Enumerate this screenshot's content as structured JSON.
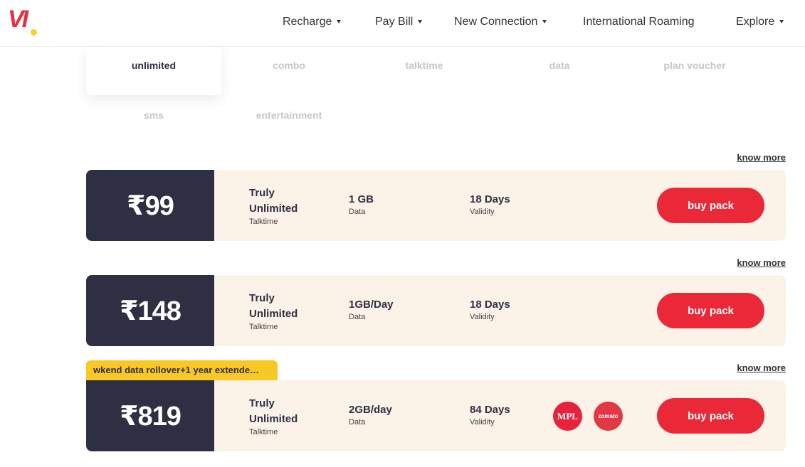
{
  "header": {
    "logo_text": "VI",
    "nav": [
      {
        "label": "Recharge",
        "has_dropdown": true
      },
      {
        "label": "Pay Bill",
        "has_dropdown": true
      },
      {
        "label": "New Connection",
        "has_dropdown": true
      },
      {
        "label": "International Roaming",
        "has_dropdown": false
      },
      {
        "label": "Explore",
        "has_dropdown": true
      }
    ]
  },
  "tabs": [
    {
      "label": "unlimited",
      "active": true
    },
    {
      "label": "combo",
      "active": false
    },
    {
      "label": "talktime",
      "active": false
    },
    {
      "label": "data",
      "active": false
    },
    {
      "label": "plan voucher",
      "active": false
    },
    {
      "label": "sms",
      "active": false
    },
    {
      "label": "entertainment",
      "active": false
    }
  ],
  "packs": [
    {
      "know_more": "know more",
      "price": "₹99",
      "talktime_line1": "Truly",
      "talktime_line2": "Unlimited",
      "talktime_label": "Talktime",
      "data_value": "1 GB",
      "data_label": "Data",
      "validity_value": "18 Days",
      "validity_label": "Validity",
      "buy_label": "buy pack"
    },
    {
      "know_more": "know more",
      "price": "₹148",
      "talktime_line1": "Truly",
      "talktime_line2": "Unlimited",
      "talktime_label": "Talktime",
      "data_value": "1GB/Day",
      "data_label": "Data",
      "validity_value": "18 Days",
      "validity_label": "Validity",
      "buy_label": "buy pack"
    },
    {
      "badge": "wkend data rollover+1 year extende…",
      "know_more": "know more",
      "price": "₹819",
      "talktime_line1": "Truly",
      "talktime_line2": "Unlimited",
      "talktime_label": "Talktime",
      "data_value": "2GB/day",
      "data_label": "Data",
      "validity_value": "84 Days",
      "validity_label": "Validity",
      "benefits": [
        {
          "name": "MPL",
          "icon": "mpl-logo-icon",
          "color": "#e8213c"
        },
        {
          "name": "zomato",
          "icon": "zomato-logo-icon",
          "color": "#e23744"
        }
      ],
      "buy_label": "buy pack"
    }
  ],
  "colors": {
    "brand_red": "#ea2838",
    "brand_yellow": "#f8c825",
    "dark_navy": "#2e2f42",
    "card_bg": "#fbf2e8"
  }
}
